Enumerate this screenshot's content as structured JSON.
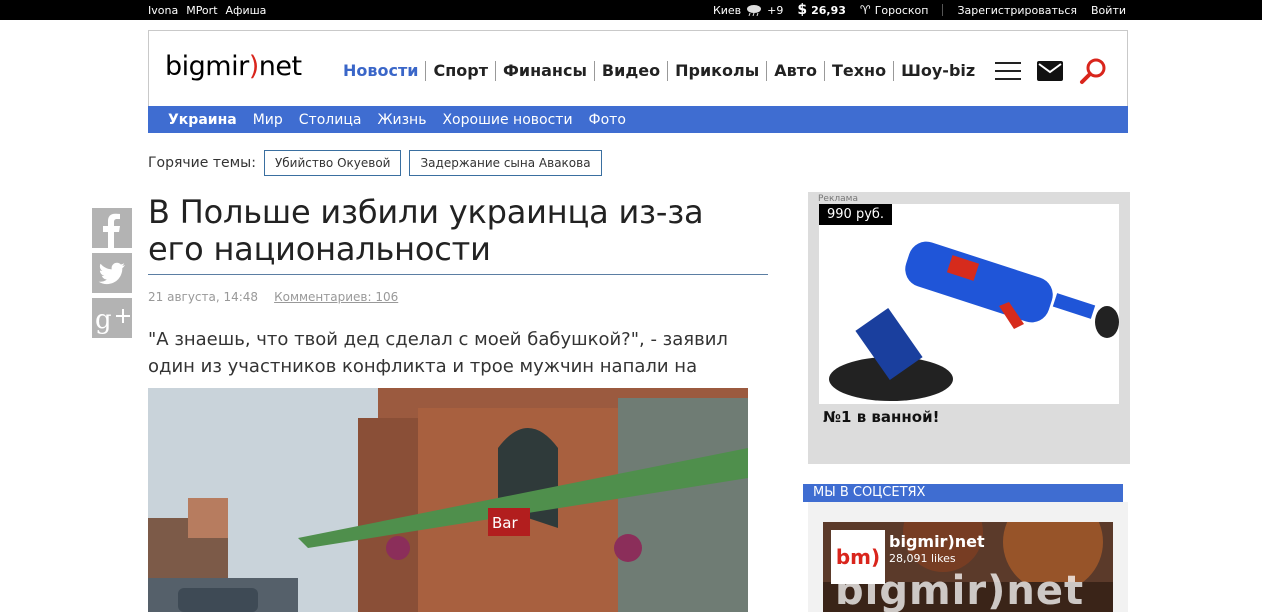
{
  "topbar": {
    "links": [
      "Ivona",
      "MPort",
      "Афиша"
    ],
    "city": "Киев",
    "temperature": "+9",
    "currency_symbol": "$",
    "currency_value": "26,93",
    "horoscope": "Гороскоп",
    "register": "Зарегистрироваться",
    "login": "Войти"
  },
  "header": {
    "logo_left": "bigmir",
    "logo_mark": ")",
    "logo_right": "net",
    "nav": [
      "Новости",
      "Спорт",
      "Финансы",
      "Видео",
      "Приколы",
      "Авто",
      "Техно",
      "Шоу-biz"
    ],
    "active_nav": "Новости"
  },
  "subnav": [
    "Украина",
    "Мир",
    "Столица",
    "Жизнь",
    "Хорошие новости",
    "Фото"
  ],
  "hot_topics": {
    "label": "Горячие темы:",
    "tags": [
      "Убийство Окуевой",
      "Задержание сына Авакова"
    ]
  },
  "article": {
    "title": "В Польше избили украинца из-за его национальности",
    "date": "21 августа, 14:48",
    "comments": "Комментариев: 106",
    "lead": "\"А знаешь, что твой дед сделал с моей бабушкой?\", - заявил один из участников конфликта и трое мужчин напали на украинца.",
    "photo_sign": "Bar"
  },
  "ad": {
    "label": "Реклама",
    "price": "990 руб.",
    "caption": "№1 в ванной!"
  },
  "social": {
    "heading": "МЫ В СОЦСЕТЯХ",
    "page_name": "bigmir)net",
    "likes": "28,091 likes",
    "thumb_text": "bm)",
    "banner_text": "bigmir)net"
  },
  "colors": {
    "accent": "#3f6dd1",
    "logo_red": "#d9251c",
    "topbar": "#000000"
  }
}
